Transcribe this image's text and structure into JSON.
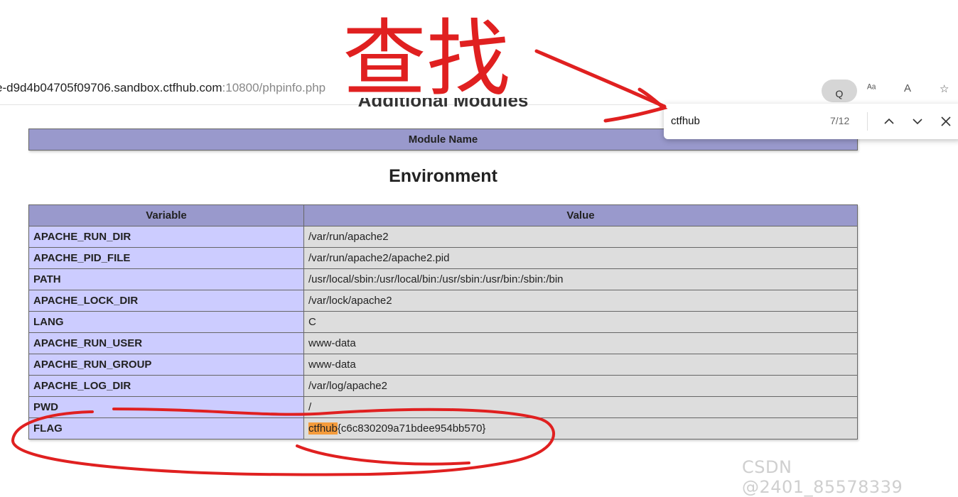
{
  "browser": {
    "url_host": "e-d9d4b04705f09706.sandbox.ctfhub.com",
    "url_rest": ":10800/phpinfo.php"
  },
  "page": {
    "modules_heading": "Additional Modules",
    "modules_header": "Module Name",
    "environment_heading": "Environment",
    "env_headers": {
      "variable": "Variable",
      "value": "Value"
    },
    "env_rows": [
      {
        "variable": "APACHE_RUN_DIR",
        "value": "/var/run/apache2"
      },
      {
        "variable": "APACHE_PID_FILE",
        "value": "/var/run/apache2/apache2.pid"
      },
      {
        "variable": "PATH",
        "value": "/usr/local/sbin:/usr/local/bin:/usr/sbin:/usr/bin:/sbin:/bin"
      },
      {
        "variable": "APACHE_LOCK_DIR",
        "value": "/var/lock/apache2"
      },
      {
        "variable": "LANG",
        "value": "C"
      },
      {
        "variable": "APACHE_RUN_USER",
        "value": "www-data"
      },
      {
        "variable": "APACHE_RUN_GROUP",
        "value": "www-data"
      },
      {
        "variable": "APACHE_LOG_DIR",
        "value": "/var/log/apache2"
      },
      {
        "variable": "PWD",
        "value": "/"
      }
    ],
    "flag_row": {
      "variable": "FLAG",
      "value_highlight": "ctfhub",
      "value_rest": "{c6c830209a71bdee954bb570}"
    }
  },
  "find_bar": {
    "query": "ctfhub",
    "count": "7/12",
    "prev_icon": "chevron-up-icon",
    "next_icon": "chevron-down-icon",
    "close_icon": "close-icon"
  },
  "annotation": {
    "text": "查找",
    "color": "#e02020"
  },
  "watermark": "CSDN @2401_85578339",
  "colors": {
    "header_bg": "#9999cc",
    "key_bg": "#ccccff",
    "value_bg": "#dddddd",
    "highlight": "#f59b3b"
  }
}
